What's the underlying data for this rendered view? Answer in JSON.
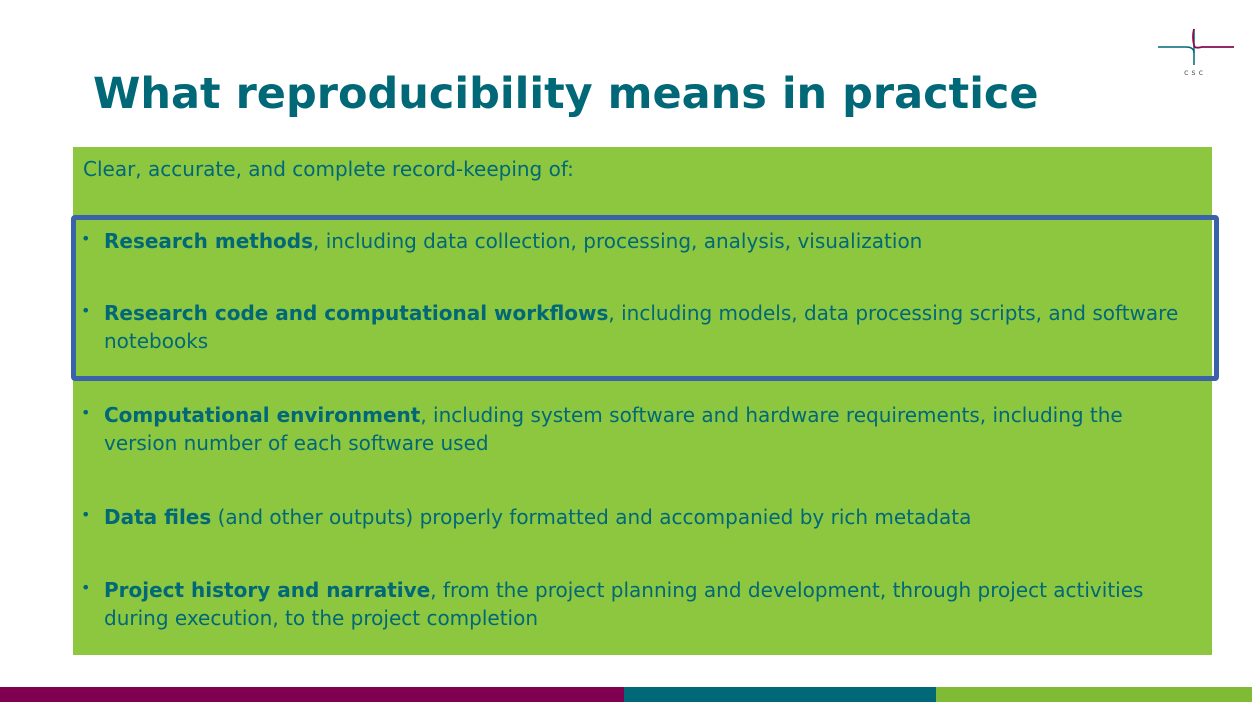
{
  "slide": {
    "title": "What reproducibility means in practice"
  },
  "logo": {
    "text": "csc",
    "accent_color": "#8a0b52",
    "line_color": "#006877"
  },
  "content": {
    "intro": "Clear, accurate, and complete record-keeping of:",
    "bullets": [
      {
        "bold": "Research methods",
        "rest": ", including data collection, processing, analysis, visualization"
      },
      {
        "bold": "Research code and computational workflows",
        "rest": ", including models, data processing scripts, and software notebooks"
      },
      {
        "bold": "Computational environment",
        "rest": ", including system software and hardware requirements, including the version number of each software used"
      },
      {
        "bold": "Data files",
        "rest": " (and other outputs) properly formatted and accompanied by rich metadata"
      },
      {
        "bold": "Project history and narrative",
        "rest": ", from the project planning and development, through project activities during execution, to the project completion"
      }
    ],
    "bullet_glyph": "•"
  },
  "colors": {
    "title": "#006877",
    "box_background": "#8dc63f",
    "highlight_frame": "#3a62a8",
    "footer": [
      "#7f0050",
      "#006877",
      "#80bb36"
    ]
  }
}
